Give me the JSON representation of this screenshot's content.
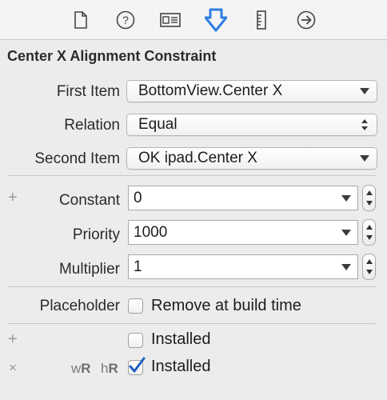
{
  "toolbar": {
    "icons": [
      {
        "name": "file-inspector-icon"
      },
      {
        "name": "quick-help-icon"
      },
      {
        "name": "identity-inspector-icon"
      },
      {
        "name": "attributes-inspector-icon",
        "selected": true
      },
      {
        "name": "size-inspector-icon"
      },
      {
        "name": "connections-inspector-icon"
      }
    ],
    "selected_color": "#2e7ee3"
  },
  "section": {
    "title": "Center X Alignment Constraint"
  },
  "fields": {
    "first_item": {
      "label": "First Item",
      "value": "BottomView.Center X"
    },
    "relation": {
      "label": "Relation",
      "value": "Equal"
    },
    "second_item": {
      "label": "Second Item",
      "value": "OK ipad.Center X"
    },
    "constant": {
      "label": "Constant",
      "value": "0"
    },
    "priority": {
      "label": "Priority",
      "value": "1000"
    },
    "multiplier": {
      "label": "Multiplier",
      "value": "1"
    }
  },
  "placeholder": {
    "label": "Placeholder",
    "option": "Remove at build time",
    "checked": false
  },
  "installed": {
    "default": {
      "label": "Installed",
      "checked": false
    },
    "variation": {
      "w": "w",
      "w_class": "R",
      "h": "h",
      "h_class": "R",
      "label": "Installed",
      "checked": true
    }
  },
  "symbols": {
    "plus": "+",
    "cross": "×"
  }
}
